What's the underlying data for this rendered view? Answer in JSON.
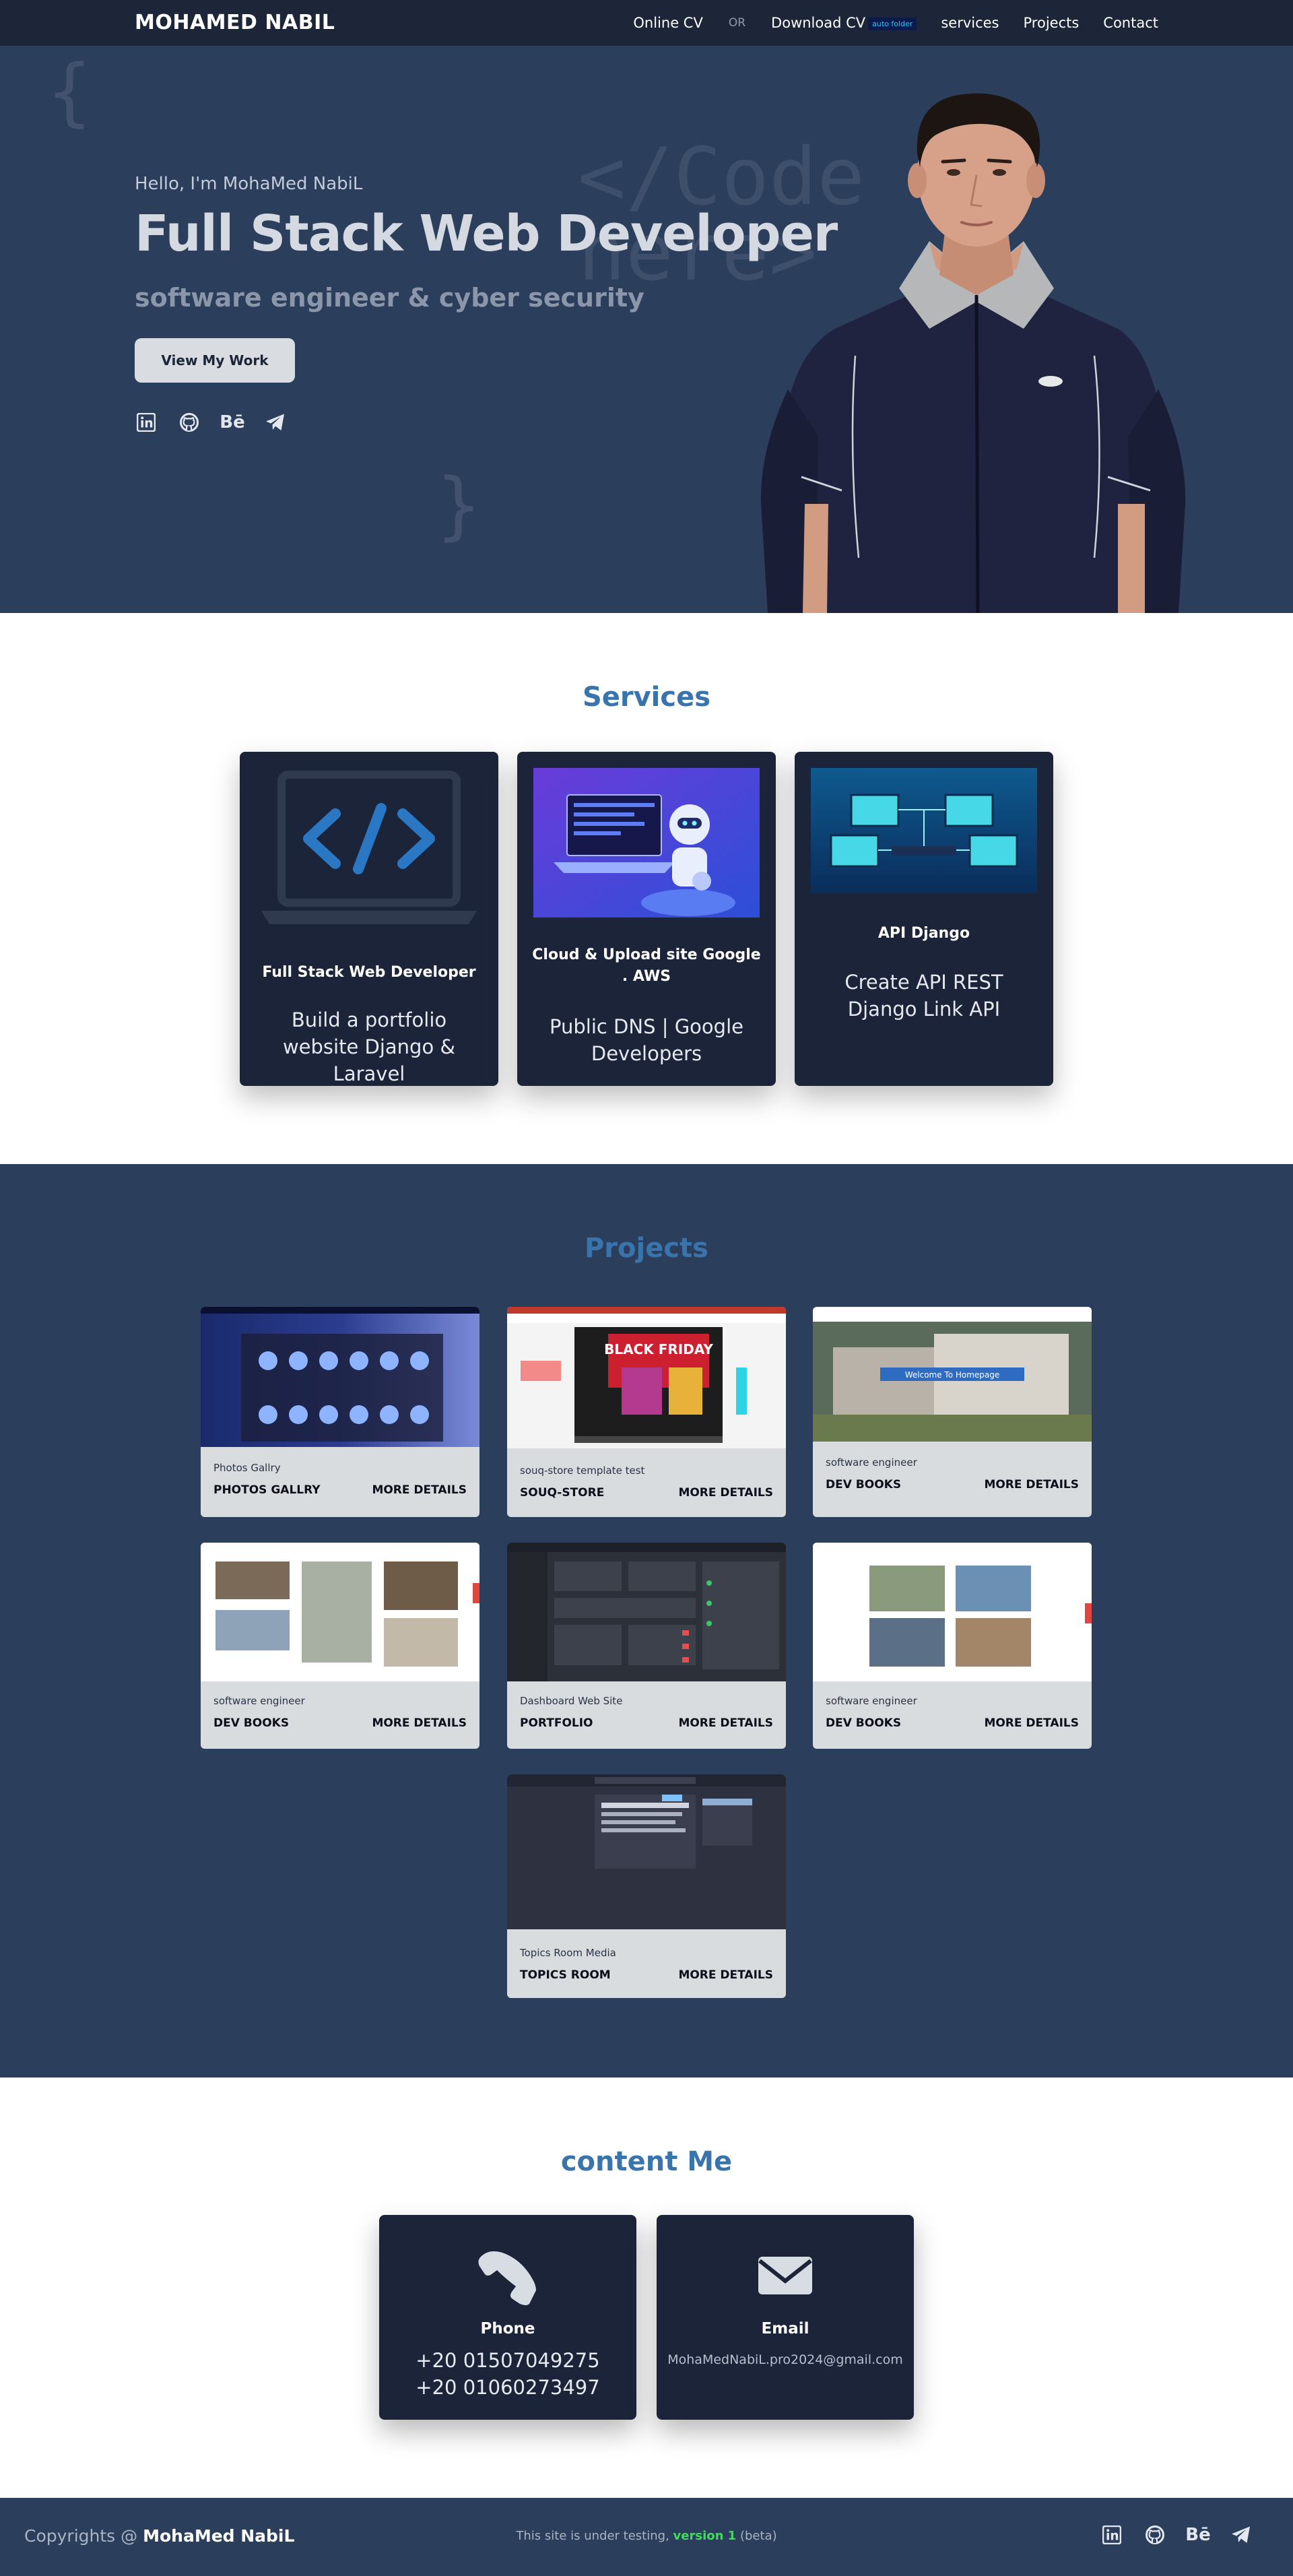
{
  "nav": {
    "brand": "MOHAMED NABIL",
    "online_cv": "Online CV",
    "or": "OR",
    "download_cv": "Download CV",
    "download_badge": "auto folder",
    "services": "services",
    "projects": "Projects",
    "contact": "Contact"
  },
  "hero": {
    "hello": "Hello, I'm MohaMed NabiL",
    "title": "Full Stack Web Developer",
    "subtitle": "software engineer & cyber security",
    "button": "View My Work",
    "code_text": "</Code\nhere>",
    "brace_open": "{",
    "brace_close": "}",
    "socials": [
      "linkedin-icon",
      "github-icon",
      "behance-icon",
      "telegram-icon"
    ],
    "behance_text": "Bē"
  },
  "services": {
    "title": "Services",
    "items": [
      {
        "name": "Full Stack Web Developer",
        "desc": "Build a portfolio website Django & Laravel"
      },
      {
        "name": "Cloud & Upload site Google . AWS",
        "desc": "Public DNS | Google Developers"
      },
      {
        "name": "API Django",
        "desc": "Create API REST Django Link API"
      }
    ]
  },
  "projects": {
    "title": "Projects",
    "more": "MORE DETAILS",
    "items": [
      {
        "category": "Photos Gallry",
        "name": "PHOTOS GALLRY"
      },
      {
        "category": "souq-store template test",
        "name": "SOUQ-STORE"
      },
      {
        "category": "software engineer",
        "name": "DEV BOOKS"
      },
      {
        "category": "software engineer",
        "name": "DEV BOOKS"
      },
      {
        "category": "Dashboard Web Site",
        "name": "PORTFOLIO"
      },
      {
        "category": "software engineer",
        "name": "DEV BOOKS"
      },
      {
        "category": "Topics Room Media",
        "name": "TOPICS ROOM"
      }
    ],
    "thumb_texts": {
      "black_friday": "BLACK FRIDAY",
      "welcome": "Welcome To Homepage"
    }
  },
  "contact": {
    "title": "content Me",
    "phone_label": "Phone",
    "phone_1": "+20 01507049275",
    "phone_2": "+20 01060273497",
    "email_label": "Email",
    "email": "MohaMedNabiL.pro2024@gmail.com"
  },
  "footer": {
    "copy_prefix": "Copyrights @",
    "copy_name": "MohaMed NabiL",
    "testing_prefix": "This site is under testing,",
    "version": "version 1",
    "beta": "(beta)"
  },
  "colors": {
    "nav_bg": "#1c2638",
    "hero_bg": "#2b3e5c",
    "card_bg": "#1b2438",
    "heading_blue": "#3a74ad",
    "version_green": "#3fdc5a"
  }
}
